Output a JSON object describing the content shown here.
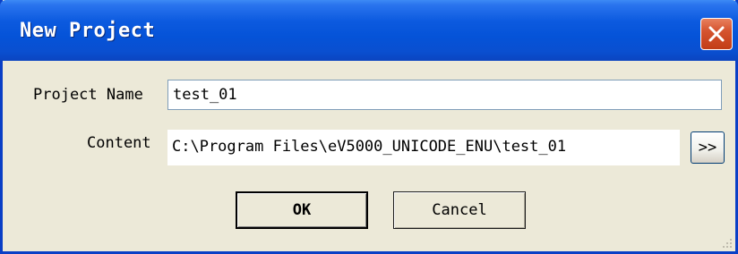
{
  "window": {
    "title": "New Project"
  },
  "form": {
    "project_name_label": "Project Name",
    "project_name_value": "test_01",
    "content_label": "Content",
    "content_value": "C:\\Program Files\\eV5000_UNICODE_ENU\\test_01",
    "browse_label": ">>"
  },
  "buttons": {
    "ok_label": "OK",
    "cancel_label": "Cancel"
  },
  "icons": {
    "close": "close-icon",
    "resize": "resize-grip-icon"
  },
  "colors": {
    "titlebar": "#0553d8",
    "close_button": "#d5532f",
    "dialog_background": "#ece9d8"
  }
}
